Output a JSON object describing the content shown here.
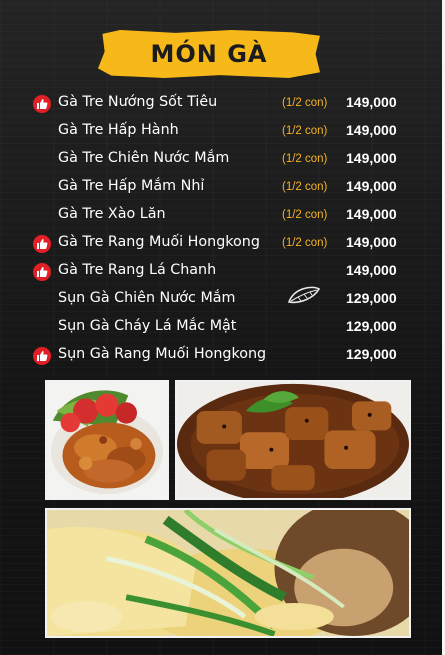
{
  "title": "MÓN GÀ",
  "colors": {
    "accent": "#f7b91a",
    "portion": "#f2b22a",
    "thumb": "#e21f26",
    "text": "#ffffff",
    "background": "#1a1a1a"
  },
  "items": [
    {
      "name": "Gà Tre Nướng Sốt Tiêu",
      "portion": "(1/2 con)",
      "price": "149,000",
      "recommended": true
    },
    {
      "name": "Gà Tre Hấp Hành",
      "portion": "(1/2 con)",
      "price": "149,000",
      "recommended": false
    },
    {
      "name": "Gà Tre Chiên Nước Mắm",
      "portion": "(1/2 con)",
      "price": "149,000",
      "recommended": false
    },
    {
      "name": "Gà Tre Hấp Mắm Nhỉ",
      "portion": "(1/2 con)",
      "price": "149,000",
      "recommended": false
    },
    {
      "name": "Gà Tre Xào Lăn",
      "portion": "(1/2 con)",
      "price": "149,000",
      "recommended": false
    },
    {
      "name": "Gà Tre Rang Muối Hongkong",
      "portion": "(1/2 con)",
      "price": "149,000",
      "recommended": true
    },
    {
      "name": "Gà Tre Rang Lá Chanh",
      "portion": "",
      "price": "149,000",
      "recommended": true
    },
    {
      "name": "Sụn Gà Chiên Nước Mắm",
      "portion": "",
      "price": "129,000",
      "recommended": false
    },
    {
      "name": "Sụn Gà Cháy Lá Mắc Mật",
      "portion": "",
      "price": "129,000",
      "recommended": false
    },
    {
      "name": "Sụn Gà Rang Muối Hongkong",
      "portion": "",
      "price": "129,000",
      "recommended": true
    }
  ],
  "icons": {
    "recommend": "thumbs-up-icon",
    "decor": "leaf-icon"
  },
  "photos": [
    {
      "name": "fried-chicken-cartilage-photo"
    },
    {
      "name": "pepper-chicken-photo"
    },
    {
      "name": "steamed-chicken-with-onion-photo"
    }
  ]
}
